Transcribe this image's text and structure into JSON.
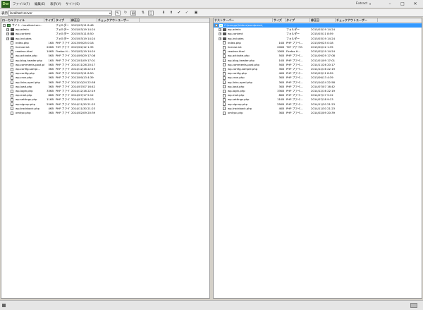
{
  "app": {
    "logo": "Dw",
    "extract_label": "Extract",
    "extract_arrow": "▾"
  },
  "menu": [
    {
      "label": "ファイル(F)"
    },
    {
      "label": "編集(E)"
    },
    {
      "label": "表示(V)"
    },
    {
      "label": "サイト(S)"
    }
  ],
  "window_controls": {
    "minimize": "–",
    "maximize": "□",
    "close": "✕"
  },
  "toolbar": {
    "show_label": "表示:",
    "site": "localhost server",
    "select_arrow": "▾"
  },
  "left_pane": {
    "columns": [
      "ローカルファイル",
      "サイズ",
      "タイプ",
      "修正日",
      "チェックアウトユーザー"
    ],
    "rows": [
      {
        "name": "サイト - localhost ser...",
        "size": "",
        "type": "フォルダー",
        "date": "2015/03/11 8:48",
        "kind": "site",
        "expand": "−",
        "depth": 0
      },
      {
        "name": "wp-admin",
        "size": "",
        "type": "フォルダー",
        "date": "2015/03/19 14:24",
        "kind": "folder",
        "expand": "+",
        "depth": 1
      },
      {
        "name": "wp-content",
        "size": "",
        "type": "フォルダー",
        "date": "2015/03/11 8:50",
        "kind": "folder",
        "expand": "+",
        "depth": 1
      },
      {
        "name": "wp-includes",
        "size": "",
        "type": "フォルダー",
        "date": "2015/03/19 14:24",
        "kind": "folder",
        "expand": "+",
        "depth": 1
      },
      {
        "name": "index.php",
        "size": "1KB",
        "type": "PHP ファイ...",
        "date": "2013/09/25 0:18",
        "kind": "file",
        "depth": 1
      },
      {
        "name": "license.txt",
        "size": "20KB",
        "type": "TXT ファイル",
        "date": "2015/02/12 1:35",
        "kind": "file",
        "depth": 1
      },
      {
        "name": "readme.html",
        "size": "10KB",
        "type": "Firefox H...",
        "date": "2015/02/19 14:24",
        "kind": "file",
        "depth": 1
      },
      {
        "name": "wp-activate.php",
        "size": "5KB",
        "type": "PHP ファイ...",
        "date": "2014/09/29 17:08",
        "kind": "file",
        "depth": 1
      },
      {
        "name": "wp-blog-header.php",
        "size": "1KB",
        "type": "PHP ファイ...",
        "date": "2012/01/09 17:01",
        "kind": "file",
        "depth": 1
      },
      {
        "name": "wp-comments-post.php",
        "size": "5KB",
        "type": "PHP ファイ...",
        "date": "2014/11/26 20:17",
        "kind": "file",
        "depth": 1
      },
      {
        "name": "wp-config-sampl...",
        "size": "3KB",
        "type": "PHP ファイ...",
        "date": "2014/12/16 22:19",
        "kind": "file",
        "depth": 1
      },
      {
        "name": "wp-config.php",
        "size": "4KB",
        "type": "PHP ファイ...",
        "date": "2015/03/11 8:50",
        "kind": "file",
        "depth": 1
      },
      {
        "name": "wp-cron.php",
        "size": "3KB",
        "type": "PHP ファイ...",
        "date": "2013/09/13 4:39",
        "kind": "file",
        "depth": 1
      },
      {
        "name": "wp-links-opml.php",
        "size": "3KB",
        "type": "PHP ファイ...",
        "date": "2013/10/24 22:58",
        "kind": "file",
        "depth": 1
      },
      {
        "name": "wp-load.php",
        "size": "3KB",
        "type": "PHP ファイ...",
        "date": "2014/07/07 16:42",
        "kind": "file",
        "depth": 1
      },
      {
        "name": "wp-login.php",
        "size": "33KB",
        "type": "PHP ファイ...",
        "date": "2014/12/16 22:19",
        "kind": "file",
        "depth": 1
      },
      {
        "name": "wp-mail.php",
        "size": "8KB",
        "type": "PHP ファイ...",
        "date": "2014/07/17 9:12",
        "kind": "file",
        "depth": 1
      },
      {
        "name": "wp-settings.php",
        "size": "11KB",
        "type": "PHP ファイ...",
        "date": "2014/07/18 9:13",
        "kind": "file",
        "depth": 1
      },
      {
        "name": "wp-signup.php",
        "size": "25KB",
        "type": "PHP ファイ...",
        "date": "2014/11/30 21:23",
        "kind": "file",
        "depth": 1
      },
      {
        "name": "wp-trackback.php",
        "size": "4KB",
        "type": "PHP ファイ...",
        "date": "2014/11/30 21:23",
        "kind": "file",
        "depth": 1
      },
      {
        "name": "xmlrpc.php",
        "size": "3KB",
        "type": "PHP ファイ...",
        "date": "2014/02/09 20:39",
        "kind": "file",
        "depth": 1
      }
    ]
  },
  "right_pane": {
    "columns": [
      "テストサーバー",
      "サイズ",
      "タイプ",
      "修正日",
      "チェックアウトユーザー"
    ],
    "rows": [
      {
        "name": "C:\\xampp\\htdocs\\wordpress\\",
        "size": "",
        "type": "",
        "date": "",
        "kind": "site",
        "expand": "−",
        "depth": 0,
        "selected": true
      },
      {
        "name": "wp-admin",
        "size": "",
        "type": "フォルダー",
        "date": "2015/03/19 14:24",
        "kind": "folder",
        "expand": "+",
        "depth": 1
      },
      {
        "name": "wp-content",
        "size": "",
        "type": "フォルダー",
        "date": "2015/03/11 8:59",
        "kind": "folder",
        "expand": "+",
        "depth": 1
      },
      {
        "name": "wp-includes",
        "size": "",
        "type": "フォルダー",
        "date": "2015/03/19 14:24",
        "kind": "folder",
        "expand": "+",
        "depth": 1
      },
      {
        "name": "index.php",
        "size": "1KB",
        "type": "PHP ファイ...",
        "date": "2013/09/25 0:18",
        "kind": "file",
        "depth": 1
      },
      {
        "name": "license.txt",
        "size": "20KB",
        "type": "TXT ファイル",
        "date": "2015/02/12 1:35",
        "kind": "file",
        "depth": 1
      },
      {
        "name": "readme.html",
        "size": "10KB",
        "type": "Firefox H...",
        "date": "2015/02/19 14:24",
        "kind": "file",
        "depth": 1
      },
      {
        "name": "wp-activate.php",
        "size": "5KB",
        "type": "PHP ファイ...",
        "date": "2014/09/29 17:08",
        "kind": "file",
        "depth": 1
      },
      {
        "name": "wp-blog-header.php",
        "size": "1KB",
        "type": "PHP ファイ...",
        "date": "2012/01/09 17:01",
        "kind": "file",
        "depth": 1
      },
      {
        "name": "wp-comments-post.php",
        "size": "5KB",
        "type": "PHP ファイ...",
        "date": "2014/11/26 20:17",
        "kind": "file",
        "depth": 1
      },
      {
        "name": "wp-config-sample.php",
        "size": "3KB",
        "type": "PHP ファイ...",
        "date": "2014/12/16 22:19",
        "kind": "file",
        "depth": 1
      },
      {
        "name": "wp-config.php",
        "size": "4KB",
        "type": "PHP ファイ...",
        "date": "2015/03/11 8:59",
        "kind": "file",
        "depth": 1
      },
      {
        "name": "wp-cron.php",
        "size": "3KB",
        "type": "PHP ファイ...",
        "date": "2013/09/13 4:39",
        "kind": "file",
        "depth": 1
      },
      {
        "name": "wp-links-opml.php",
        "size": "3KB",
        "type": "PHP ファイ...",
        "date": "2013/10/24 22:58",
        "kind": "file",
        "depth": 1
      },
      {
        "name": "wp-load.php",
        "size": "3KB",
        "type": "PHP ファイ...",
        "date": "2014/07/07 16:42",
        "kind": "file",
        "depth": 1
      },
      {
        "name": "wp-login.php",
        "size": "33KB",
        "type": "PHP ファイ...",
        "date": "2014/12/16 22:19",
        "kind": "file",
        "depth": 1
      },
      {
        "name": "wp-mail.php",
        "size": "8KB",
        "type": "PHP ファイ...",
        "date": "2014/07/17 9:12",
        "kind": "file",
        "depth": 1
      },
      {
        "name": "wp-settings.php",
        "size": "11KB",
        "type": "PHP ファイ...",
        "date": "2014/07/18 9:13",
        "kind": "file",
        "depth": 1
      },
      {
        "name": "wp-signup.php",
        "size": "25KB",
        "type": "PHP ファイ...",
        "date": "2014/11/30 21:23",
        "kind": "file",
        "depth": 1
      },
      {
        "name": "wp-trackback.php",
        "size": "4KB",
        "type": "PHP ファイ...",
        "date": "2014/11/30 21:23",
        "kind": "file",
        "depth": 1
      },
      {
        "name": "xmlrpc.php",
        "size": "3KB",
        "type": "PHP ファイ...",
        "date": "2014/02/09 20:39",
        "kind": "file",
        "depth": 1
      }
    ]
  }
}
